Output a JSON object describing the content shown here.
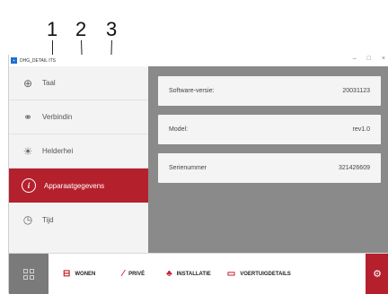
{
  "callouts": [
    "1",
    "2",
    "3"
  ],
  "window": {
    "title": "DHG_DETAIL ITS",
    "app_icon": "app-icon",
    "controls": [
      "–",
      "□",
      "×"
    ]
  },
  "sidebar": {
    "items": [
      {
        "label": "Taal",
        "icon": "globe-icon"
      },
      {
        "label": "Verbindin",
        "icon": "link-icon"
      },
      {
        "label": "Helderhei",
        "icon": "brightness-icon"
      },
      {
        "label": "Apparaatgegevens",
        "icon": "info-icon",
        "active": true
      },
      {
        "label": "Tijd",
        "icon": "clock-icon"
      }
    ]
  },
  "details": [
    {
      "label": "Software-versie:",
      "value": "20031123"
    },
    {
      "label": "Model:",
      "value": "rev1.0"
    },
    {
      "label": "Serienummer",
      "value": "321426609"
    }
  ],
  "bottom_tabs": [
    {
      "label": "WONEN",
      "icon": "home-icon"
    },
    {
      "label": "PRIVÉ",
      "icon": "privacy-icon"
    },
    {
      "label": "INSTALLATIE",
      "icon": "installation-icon"
    },
    {
      "label": "VOERTUIGDETAILS",
      "icon": "vehicle-icon"
    }
  ],
  "colors": {
    "accent": "#b5202d",
    "main_background": "#8a8a8a",
    "sidebar_background": "#f3f3f3"
  }
}
